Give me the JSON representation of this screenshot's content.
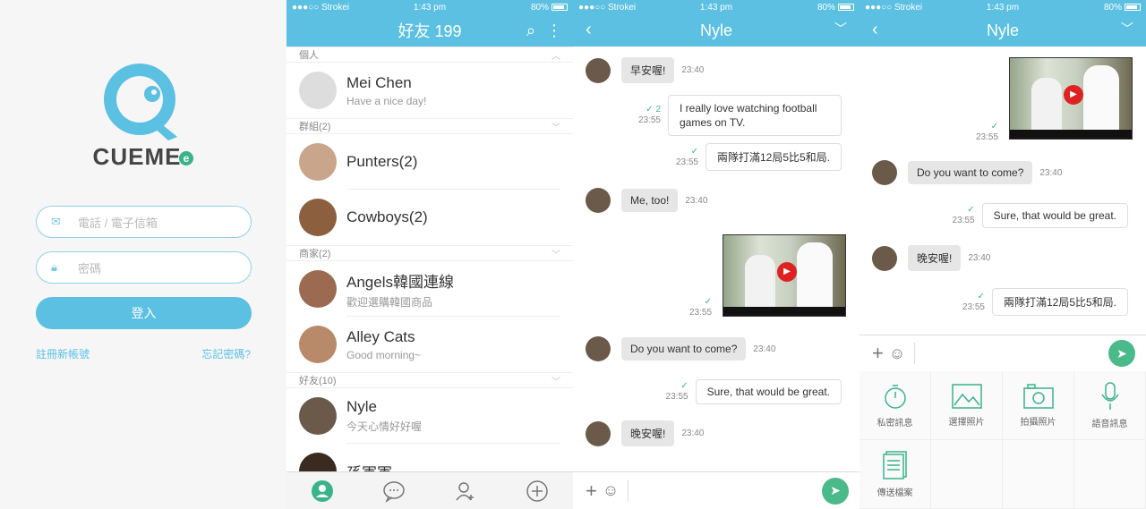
{
  "status": {
    "carrier": "●●●○○ Strokei",
    "time": "1:43 pm",
    "battery": "80%"
  },
  "login": {
    "brand": "CUEME",
    "brand_e": "e",
    "phone_placeholder": "電話 / 電子信箱",
    "password_placeholder": "密碼",
    "login_button": "登入",
    "register_link": "註冊新帳號",
    "forgot_link": "忘記密碼?",
    "accent": "#5bc0e2"
  },
  "contacts": {
    "title": "好友 199",
    "sections": {
      "personal": "個人",
      "groups": "群組(2)",
      "merchants": "商家(2)",
      "friends": "好友(10)"
    },
    "me": {
      "name": "Mei Chen",
      "status": "Have a nice day!"
    },
    "groups": [
      {
        "name": "Punters(2)"
      },
      {
        "name": "Cowboys(2)"
      }
    ],
    "merchants": [
      {
        "name": "Angels韓國連線",
        "status": "歡迎選購韓國商品"
      },
      {
        "name": "Alley Cats",
        "status": "Good morning~"
      }
    ],
    "friends": [
      {
        "name": "Nyle",
        "status": "今天心情好好喔"
      },
      {
        "name": "孫軍軍",
        "status": ""
      }
    ]
  },
  "chat": {
    "title": "Nyle",
    "messages": [
      {
        "text": "早安喔!",
        "time": "23:40"
      },
      {
        "text": "I really love watching football games on TV.",
        "time": "23:55",
        "read": "2"
      },
      {
        "text": "兩隊打滿12局5比5和局.",
        "time": "23:55"
      },
      {
        "text": "Me, too!",
        "time": "23:40"
      },
      {
        "text": "",
        "time": "23:55"
      },
      {
        "text": "Do you want to come?",
        "time": "23:40"
      },
      {
        "text": "Sure, that would be great.",
        "time": "23:55"
      },
      {
        "text": "晚安喔!",
        "time": "23:40"
      }
    ]
  },
  "chat2": {
    "title": "Nyle",
    "video_time": "23:55",
    "messages": [
      {
        "text": "Do you want to come?",
        "time": "23:40"
      },
      {
        "text": "Sure, that would be great.",
        "time": "23:55"
      },
      {
        "text": "晚安喔!",
        "time": "23:40"
      },
      {
        "text": "兩隊打滿12局5比5和局.",
        "time": "23:55"
      }
    ],
    "attachments": {
      "private": "私密訊息",
      "choose_photo": "選擇照片",
      "take_photo": "拍攝照片",
      "voice": "語音訊息",
      "send_file": "傳送檔案"
    }
  }
}
